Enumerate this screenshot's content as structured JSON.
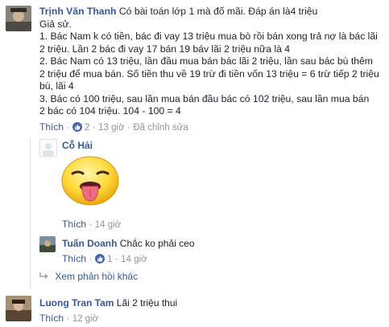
{
  "comment1": {
    "author": "Trịnh Văn Thanh",
    "text_first": "Có bài toán lớp 1 mà đố mãi. Đáp án là4 triệu",
    "lines": [
      "Giả sử.",
      "1. Bác Nam k có tiền, bác đi vay 13 triệu mua bò rồi bán xong trả nợ là bác lãi",
      "2 triệu. Lần 2 bác đi vay 17 bán 19 báv lãi 2 triệu nữa là 4",
      "2. Bác Nam có 13 triệu, lần đầu mua bán bác lãi 2 triệu, lần sau bác bù thêm",
      "2 triệu để mua bán. Số tiền thu về 19 trừ đi tiền vốn 13 triệu = 6 trừ tiếp 2 triệu",
      "bù, lãi 4",
      "3. Bác có 100 triệu, sau lần mua bán đầu bác có 102 triệu, sau lần mua bán",
      "2 bác có 104 triệu. 104 - 100 = 4"
    ],
    "like_label": "Thích",
    "like_count": "2",
    "time": "13 giờ",
    "edited": "Đã chỉnh sửa"
  },
  "reply1": {
    "author": "Cỗ Hải",
    "like_label": "Thích",
    "time": "14 giờ"
  },
  "reply2": {
    "author": "Tuấn Doanh",
    "text": "Chắc ko phải ceo",
    "like_label": "Thích",
    "like_count": "1",
    "time": "14 giờ"
  },
  "more_replies": "Xem phản hồi khác",
  "comment2": {
    "author": "Luong Tran Tam",
    "text": "Lãi 2 triệu thui",
    "like_label": "Thích",
    "time": "12 giờ"
  },
  "colors": {
    "link": "#365899",
    "meta": "#90949c",
    "like_badge": "#4267b2"
  }
}
